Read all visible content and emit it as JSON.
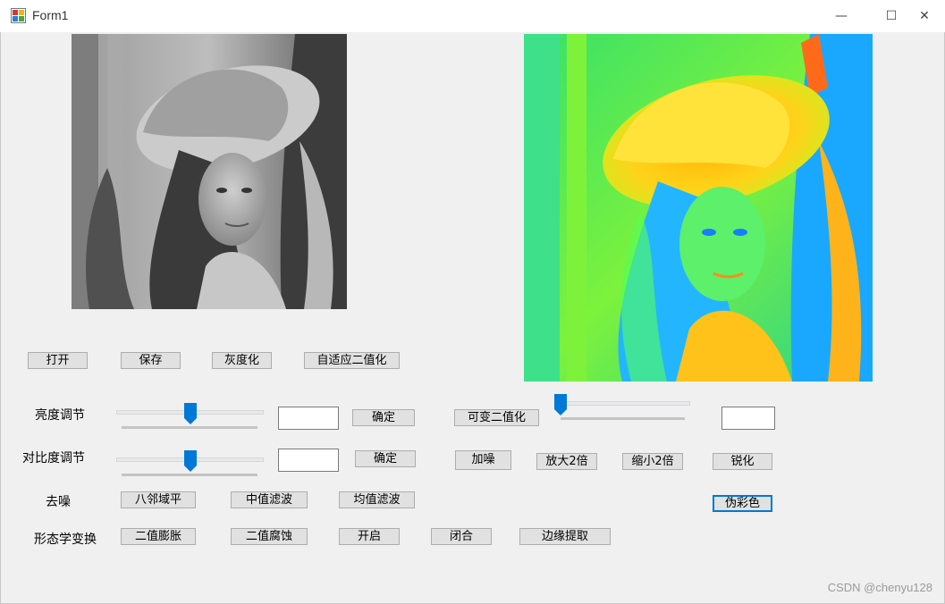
{
  "window": {
    "title": "Form1",
    "minimize_glyph": "—",
    "maximize_glyph": "☐",
    "close_glyph": "✕"
  },
  "images": {
    "original": {
      "description_icon": "grayscale-photo"
    },
    "result": {
      "description_icon": "false-color-photo"
    }
  },
  "file_buttons": [
    "打开",
    "保存",
    "灰度化",
    "自适应二值化"
  ],
  "brightness": {
    "label": "亮度调节",
    "value": "",
    "confirm": "确定",
    "slider_position": 0.5
  },
  "contrast": {
    "label": "对比度调节",
    "value": "",
    "confirm": "确定",
    "slider_position": 0.5
  },
  "binarize": {
    "button": "可变二值化",
    "value": "",
    "slider_position": 0.0
  },
  "row2_buttons": [
    "加噪",
    "放大2倍",
    "缩小2倍",
    "锐化"
  ],
  "denoise": {
    "label": "去噪",
    "buttons": [
      "八邻域平",
      "中值滤波",
      "均值滤波"
    ]
  },
  "pseudocolor_button": "伪彩色",
  "morphology": {
    "label": "形态学变换",
    "buttons": [
      "二值膨胀",
      "二值腐蚀",
      "开启",
      "闭合",
      "边缘提取"
    ]
  },
  "watermark": "CSDN @chenyu128",
  "colors": {
    "accent": "#0078d7",
    "button_face": "#e1e1e1",
    "form_bg": "#f0f0f0"
  }
}
